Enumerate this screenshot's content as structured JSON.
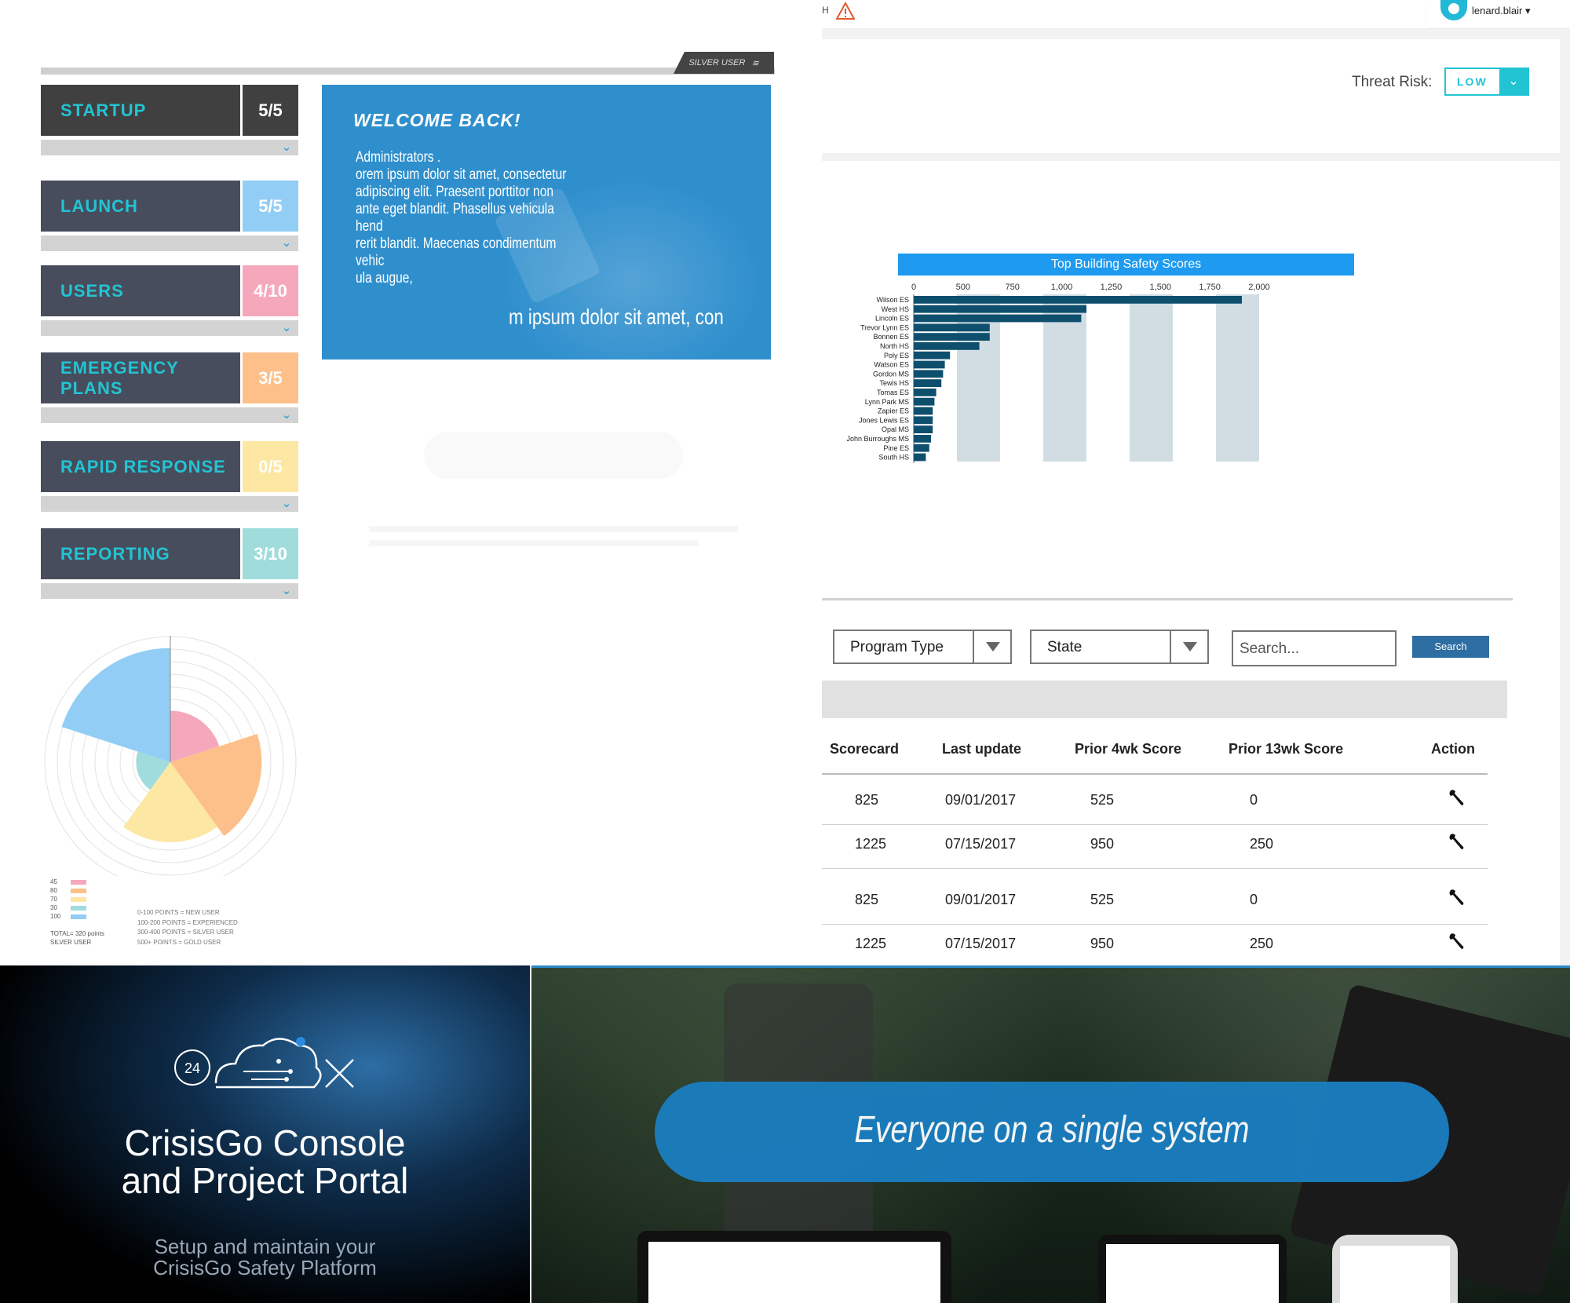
{
  "left": {
    "badge": "SILVER USER",
    "stages": [
      {
        "name": "STARTUP",
        "score": "5/5",
        "color": "#404040"
      },
      {
        "name": "LAUNCH",
        "score": "5/5",
        "color": "#92cdf5"
      },
      {
        "name": "USERS",
        "score": "4/10",
        "color": "#f5a8bb"
      },
      {
        "name": "EMERGENCY PLANS",
        "score": "3/5",
        "color": "#fdc08a"
      },
      {
        "name": "RAPID RESPONSE",
        "score": "0/5",
        "color": "#fce7a3"
      },
      {
        "name": "REPORTING",
        "score": "3/10",
        "color": "#a0dcdc"
      }
    ],
    "welcome": {
      "title": "WELCOME BACK!",
      "lines": [
        "Administrators .",
        "orem ipsum dolor sit amet, consectetur",
        "adipiscing elit. Praesent porttitor non",
        "ante eget blandit. Phasellus vehicula hend",
        "rerit blandit. Maecenas condimentum vehic",
        "ula augue,"
      ],
      "bottom": "m ipsum dolor sit amet, con"
    },
    "radar_legend": {
      "values": [
        "45",
        "80",
        "70",
        "30",
        "100"
      ],
      "colors": [
        "#f5a8bb",
        "#fdc08a",
        "#fce7a3",
        "#a0dcdc",
        "#92cdf5"
      ],
      "tiers": [
        "0-100 POINTS = NEW USER",
        "100-200 POINTS = EXPERIENCED",
        "300-400 POINTS = SILVER USER",
        "500+ POINTS = GOLD USER"
      ],
      "total": "TOTAL= 320 points",
      "level": "SILVER USER"
    }
  },
  "header": {
    "fragment": "H",
    "username": "lenard.blair",
    "threat_label": "Threat Risk:",
    "threat_value": "LOW"
  },
  "chart_data": {
    "type": "bar",
    "title": "Top Building Safety Scores",
    "xlim": [
      0,
      2000
    ],
    "x_ticks": [
      "0",
      "500",
      "750",
      "1,000",
      "1,250",
      "1,500",
      "1,750",
      "2,000"
    ],
    "categories": [
      "Wilson ES",
      "West HS",
      "Lincoln ES",
      "Trevor Lynn ES",
      "Bonnen ES",
      "North HS",
      "Poly ES",
      "Watson ES",
      "Gordon MS",
      "Tewis HS",
      "Tomas ES",
      "Lynn Park MS",
      "Zapier ES",
      "Jones Lewis ES",
      "Opal MS",
      "John Burroughs MS",
      "Pine ES",
      "South HS"
    ],
    "values": [
      1900,
      1000,
      970,
      440,
      440,
      380,
      210,
      180,
      170,
      160,
      130,
      120,
      110,
      110,
      110,
      100,
      90,
      70
    ]
  },
  "filters": {
    "program_type": "Program Type",
    "state": "State",
    "search_placeholder": "Search...",
    "search_button": "Search"
  },
  "table": {
    "headers": [
      "Scorecard",
      "Last update",
      "Prior 4wk Score",
      "Prior 13wk Score",
      "Action"
    ],
    "rows": [
      [
        "825",
        "09/01/2017",
        "525",
        "0"
      ],
      [
        "1225",
        "07/15/2017",
        "950",
        "250"
      ],
      [
        "825",
        "09/01/2017",
        "525",
        "0"
      ],
      [
        "1225",
        "07/15/2017",
        "950",
        "250"
      ]
    ]
  },
  "banner_left": {
    "title_line1": "CrisisGo Console",
    "title_line2": "and Project Portal",
    "sub_line1": "Setup and maintain your",
    "sub_line2": "CrisisGo Safety Platform",
    "logo_number": "24"
  },
  "banner_right": {
    "headline": "Everyone on a single system"
  }
}
